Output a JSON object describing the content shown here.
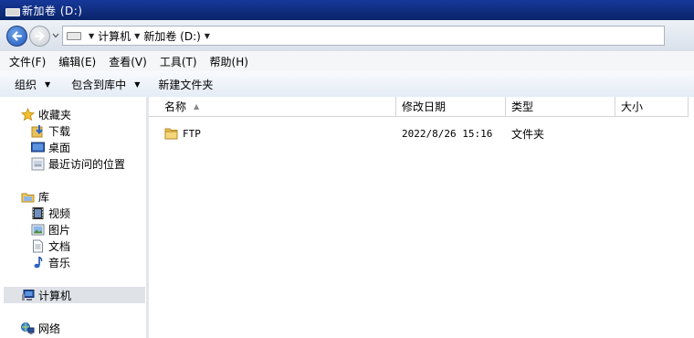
{
  "window": {
    "title": "新加卷 (D:)"
  },
  "address": {
    "crumbs": [
      "计算机",
      "新加卷 (D:)"
    ]
  },
  "menu": [
    "文件(F)",
    "编辑(E)",
    "查看(V)",
    "工具(T)",
    "帮助(H)"
  ],
  "toolbar": {
    "organize": "组织",
    "include_library": "包含到库中",
    "new_folder": "新建文件夹"
  },
  "nav": {
    "favorites": "收藏夹",
    "favorites_items": [
      "下载",
      "桌面",
      "最近访问的位置"
    ],
    "libraries": "库",
    "library_items": [
      "视频",
      "图片",
      "文档",
      "音乐"
    ],
    "computer": "计算机",
    "network": "网络"
  },
  "columns": {
    "name": "名称",
    "modified": "修改日期",
    "type": "类型",
    "size": "大小"
  },
  "files": [
    {
      "name": "FTP",
      "modified": "2022/8/26 15:16",
      "type": "文件夹",
      "size": ""
    }
  ],
  "icons": {
    "back": "back-arrow-icon",
    "forward": "forward-arrow-icon",
    "drive": "drive-icon",
    "folder": "folder-icon",
    "star": "star-icon",
    "computer": "computer-icon",
    "network": "network-icon"
  },
  "colors": {
    "titlebar": "#0b2a7a",
    "selected_nav": "#dfe3e8",
    "back_button": "#1f56b8"
  }
}
